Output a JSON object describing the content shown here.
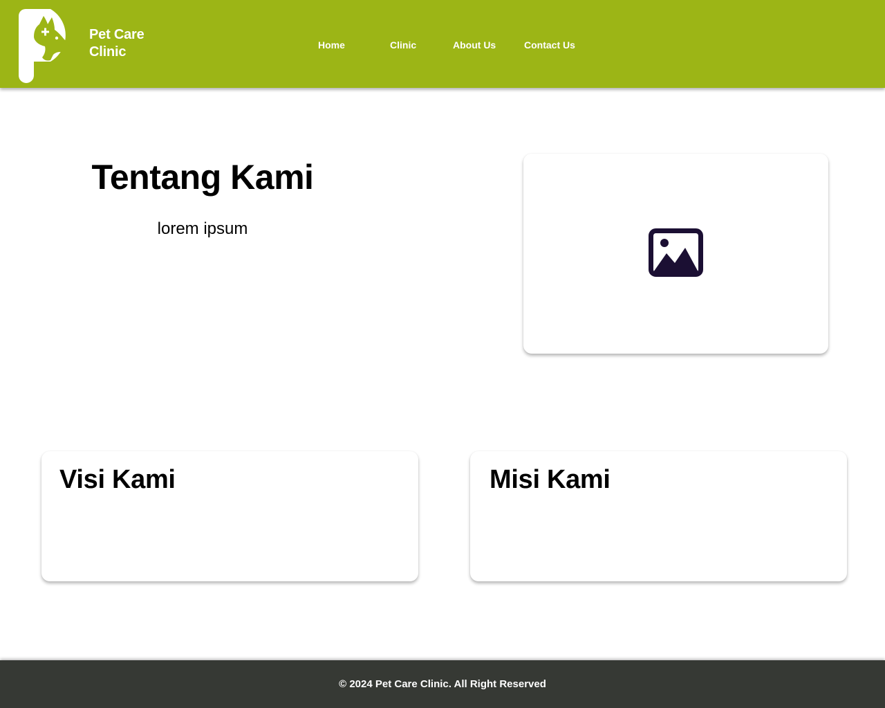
{
  "header": {
    "brand_line1": "Pet Care",
    "brand_line2": "Clinic",
    "logo_icon": "pet-clinic-logo-icon",
    "background_color": "#9cb516"
  },
  "nav": {
    "items": [
      {
        "label": "Home"
      },
      {
        "label": "Clinic"
      },
      {
        "label": "About Us"
      },
      {
        "label": "Contact Us"
      }
    ]
  },
  "about": {
    "title": "Tentang Kami",
    "text": "lorem ipsum",
    "image_icon": "image-placeholder-icon"
  },
  "vision": {
    "title": "Visi Kami"
  },
  "mission": {
    "title": "Misi Kami"
  },
  "footer": {
    "text": "© 2024 Pet Care Clinic. All Right Reserved",
    "background_color": "#363934"
  }
}
